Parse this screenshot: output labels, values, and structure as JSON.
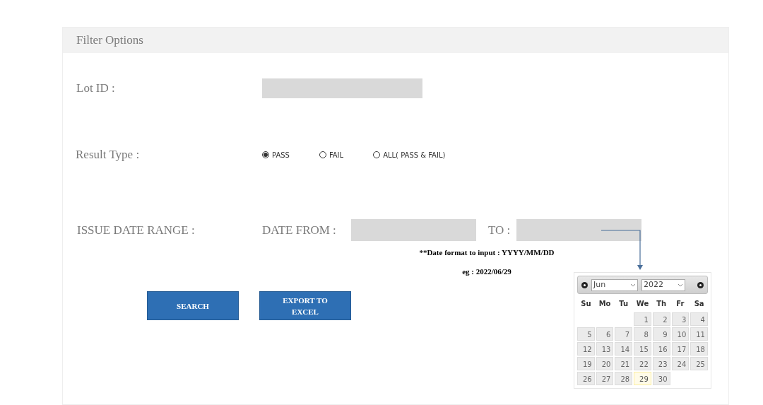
{
  "panel": {
    "title": "Filter Options"
  },
  "lot_id": {
    "label": "Lot ID :"
  },
  "result_type": {
    "label": "Result Type :",
    "options": [
      {
        "label": "PASS",
        "selected": true
      },
      {
        "label": "FAIL",
        "selected": false
      },
      {
        "label": "ALL( PASS & FAIL)",
        "selected": false
      }
    ]
  },
  "issue_date": {
    "label": "ISSUE DATE RANGE :",
    "from_label": "DATE FROM :",
    "to_label": "TO :",
    "hint": "**Date format to input : YYYY/MM/DD",
    "example": "eg : 2022/06/29"
  },
  "buttons": [
    {
      "label": "SEARCH"
    },
    {
      "label": "EXPORT TO EXCEL"
    }
  ],
  "calendar": {
    "month": "Jun",
    "year": "2022",
    "weekdays": [
      "Su",
      "Mo",
      "Tu",
      "We",
      "Th",
      "Fr",
      "Sa"
    ],
    "weeks": [
      [
        {
          "kind": "blank"
        },
        {
          "kind": "blank"
        },
        {
          "kind": "blank"
        },
        {
          "label": "1",
          "today": false
        },
        {
          "label": "2",
          "today": false
        },
        {
          "label": "3",
          "today": false
        },
        {
          "label": "4",
          "today": false
        }
      ],
      [
        {
          "label": "5",
          "today": false
        },
        {
          "label": "6",
          "today": false
        },
        {
          "label": "7",
          "today": false
        },
        {
          "label": "8",
          "today": false
        },
        {
          "label": "9",
          "today": false
        },
        {
          "label": "10",
          "today": false
        },
        {
          "label": "11",
          "today": false
        }
      ],
      [
        {
          "label": "12",
          "today": false
        },
        {
          "label": "13",
          "today": false
        },
        {
          "label": "14",
          "today": false
        },
        {
          "label": "15",
          "today": false
        },
        {
          "label": "16",
          "today": false
        },
        {
          "label": "17",
          "today": false
        },
        {
          "label": "18",
          "today": false
        }
      ],
      [
        {
          "label": "19",
          "today": false
        },
        {
          "label": "20",
          "today": false
        },
        {
          "label": "21",
          "today": false
        },
        {
          "label": "22",
          "today": false
        },
        {
          "label": "23",
          "today": false
        },
        {
          "label": "24",
          "today": false
        },
        {
          "label": "25",
          "today": false
        }
      ],
      [
        {
          "label": "26",
          "today": false
        },
        {
          "label": "27",
          "today": false
        },
        {
          "label": "28",
          "today": false
        },
        {
          "label": "29",
          "today": true
        },
        {
          "label": "30",
          "today": false
        },
        {
          "kind": "blank"
        },
        {
          "kind": "blank"
        }
      ]
    ]
  }
}
